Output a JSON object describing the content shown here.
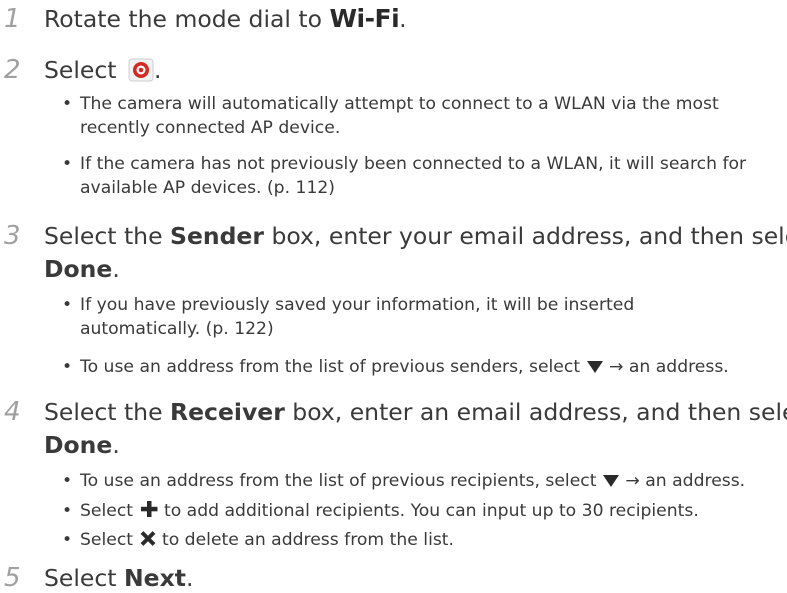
{
  "steps": [
    {
      "num": "1",
      "pre": "Rotate the mode dial to ",
      "mode": "Wi-Fi",
      "post": "."
    },
    {
      "num": "2",
      "pre": "Select ",
      "post": "."
    },
    {
      "num": "3",
      "a": "Select the ",
      "b": "Sender",
      "c": " box, enter your email address, and then select",
      "d": "Done",
      "e": "."
    },
    {
      "num": "4",
      "a": "Select the ",
      "b": "Receiver",
      "c": " box, enter an email address, and then select",
      "d": "Done",
      "e": "."
    },
    {
      "num": "5",
      "a": "Select ",
      "b": "Next",
      "c": "."
    }
  ],
  "bullets": {
    "s2b1_l1": "The camera will automatically attempt to connect to a WLAN via the most",
    "s2b1_l2": "recently connected AP device.",
    "s2b2_l1": "If the camera has not previously been connected to a WLAN, it will search for",
    "s2b2_l2": "available AP devices. (p. 112)",
    "s3b1_l1": "If you have previously saved your information, it will be inserted",
    "s3b1_l2": "automatically. (p. 122)",
    "s3b2_pre": "To use an address from the list of previous senders, select ",
    "s3b2_post": " → an address.",
    "s4b1_pre": "To use an address from the list of previous recipients, select ",
    "s4b1_post": " → an address.",
    "s4b2_pre": "Select ",
    "s4b2_post": " to add additional recipients. You can input up to 30 recipients.",
    "s4b3_pre": "Select ",
    "s4b3_post": " to delete an address from the list."
  },
  "icons": {
    "email": "email-app-icon",
    "dropdown": "triangle-down-icon",
    "add": "plus-icon",
    "delete": "x-icon"
  },
  "colors": {
    "text": "#3a3a3a",
    "step_number": "#a0a0a0",
    "email_icon": "#d42a22"
  }
}
